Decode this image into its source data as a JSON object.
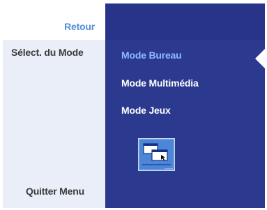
{
  "menu": {
    "back_label": "Retour",
    "section_label": "Sélect. du Mode",
    "quit_label": "Quitter Menu"
  },
  "modes": [
    {
      "label": "Mode Bureau",
      "selected": true
    },
    {
      "label": "Mode Multimédia",
      "selected": false
    },
    {
      "label": "Mode Jeux",
      "selected": false
    }
  ],
  "icons": {
    "selection_arrow": "triangle-left-arrow-icon",
    "mode_preview": "desktop-windows-icon"
  },
  "colors": {
    "left_panel": "#e9eef8",
    "right_panel": "#2b3a8e",
    "back_text": "#4f8fd8",
    "selected_text": "#8fb8ff"
  }
}
